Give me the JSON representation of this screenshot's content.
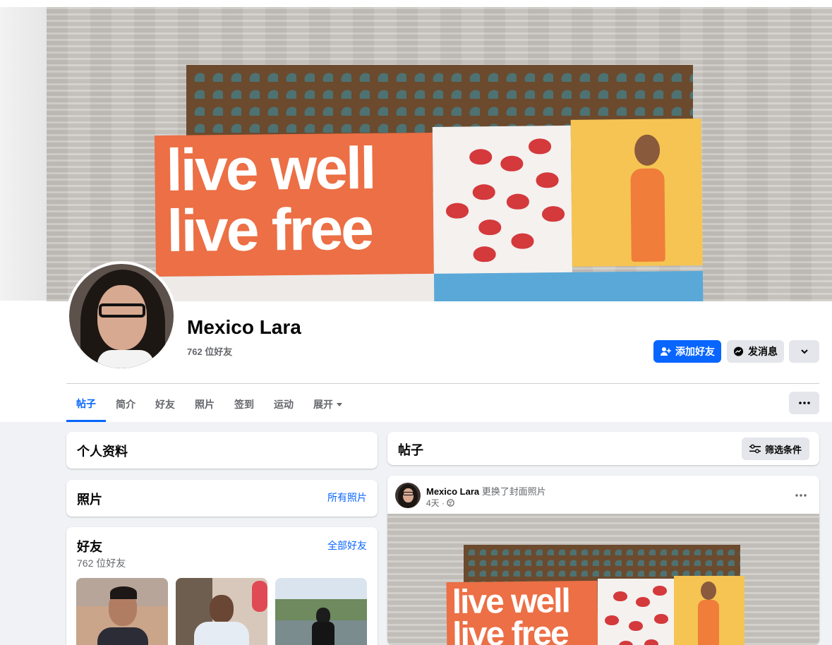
{
  "cover": {
    "banner_text_line1": "live well",
    "banner_text_line2": "live free"
  },
  "profile": {
    "name": "Mexico Lara",
    "friend_count": "762 位好友",
    "buttons": {
      "add_friend": "添加好友",
      "message": "发消息"
    }
  },
  "tabs": [
    {
      "label": "帖子",
      "active": true
    },
    {
      "label": "简介"
    },
    {
      "label": "好友"
    },
    {
      "label": "照片"
    },
    {
      "label": "签到"
    },
    {
      "label": "运动"
    },
    {
      "label": "展开"
    }
  ],
  "left": {
    "intro": {
      "title": "个人资料"
    },
    "photos": {
      "title": "照片",
      "link": "所有照片"
    },
    "friends": {
      "title": "好友",
      "link": "全部好友",
      "count": "762 位好友"
    }
  },
  "posts": {
    "header": {
      "title": "帖子",
      "filter": "筛选条件"
    },
    "post1": {
      "author": "Mexico Lara",
      "action": "更换了封面照片",
      "time": "4天 ·"
    }
  },
  "colors": {
    "accent": "#0866ff",
    "background": "#f0f2f5",
    "secondary_text": "#65676b"
  }
}
